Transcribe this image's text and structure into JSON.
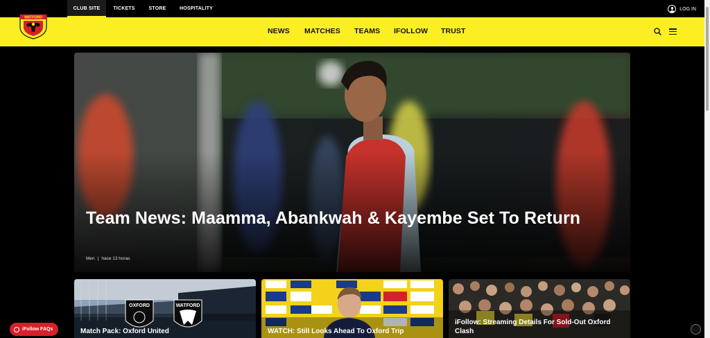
{
  "topbar": {
    "tabs": [
      "CLUB SITE",
      "TICKETS",
      "STORE",
      "HOSPITALITY"
    ],
    "login_label": "LOG IN"
  },
  "brand": {
    "crest_text": "WATFORD",
    "yellow": "#fbee23",
    "red": "#d7212a",
    "black": "#000000"
  },
  "nav": {
    "items": [
      "NEWS",
      "MATCHES",
      "TEAMS",
      "IFOLLOW",
      "TRUST"
    ]
  },
  "hero": {
    "title": "Team News: Maamma, Abankwah & Kayembe Set To Return",
    "category": "Men",
    "separator": "|",
    "time": "hace 13 horas"
  },
  "cards": [
    {
      "title": "Match Pack: Oxford United"
    },
    {
      "title": "WATCH: Still Looks Ahead To Oxford Trip"
    },
    {
      "title": "iFollow: Streaming Details For Sold-Out Oxford Clash"
    }
  ],
  "crests": {
    "left": "OXFORD",
    "right": "WATFORD"
  },
  "faq_button": "iFollow FAQs"
}
